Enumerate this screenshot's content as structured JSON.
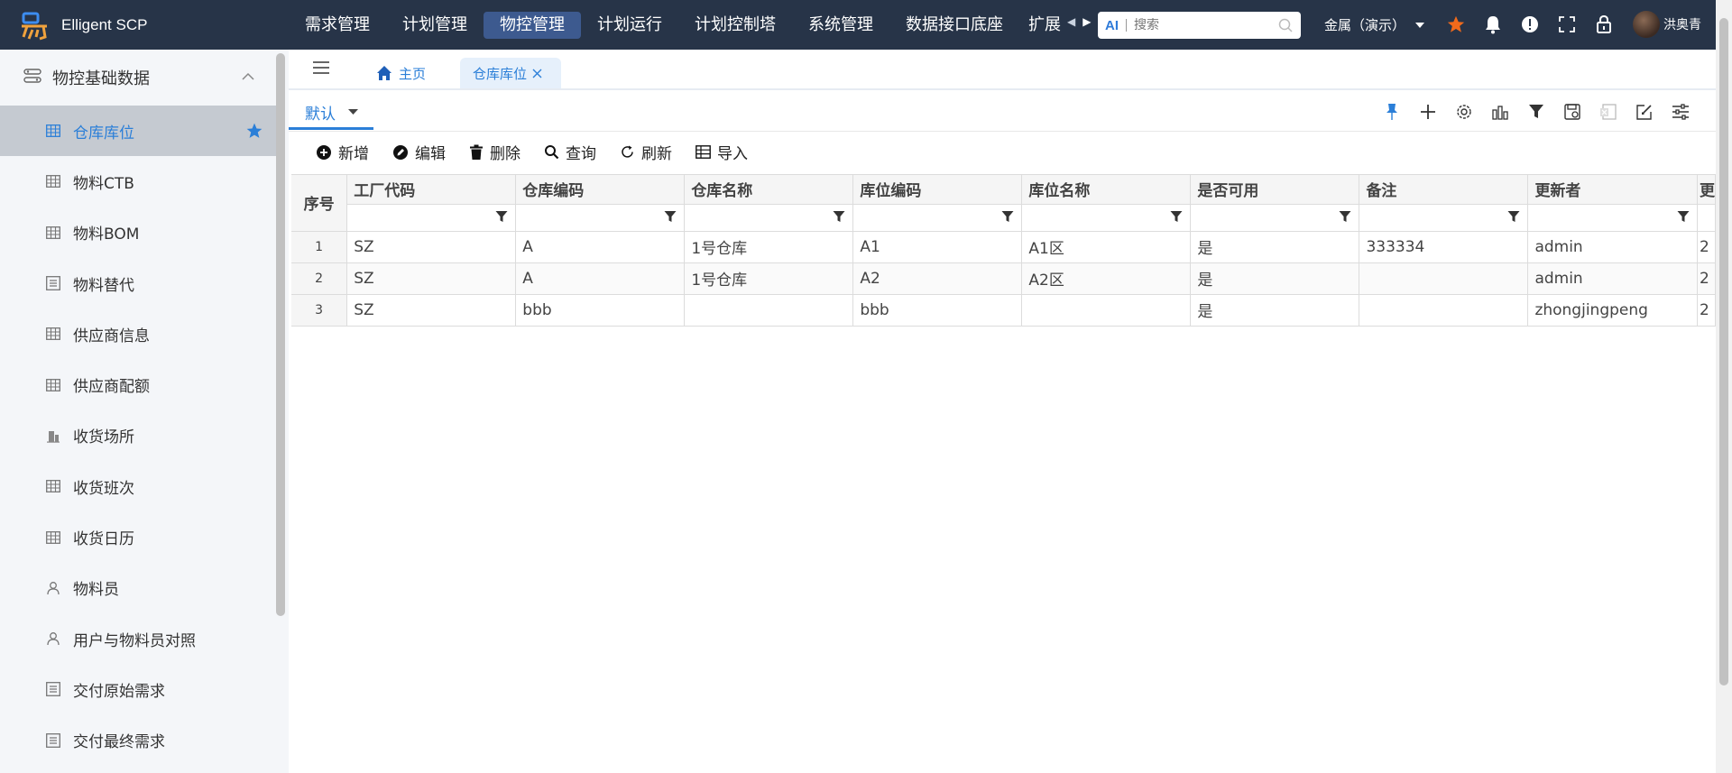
{
  "app": {
    "name": "Elligent SCP"
  },
  "nav": {
    "items": [
      "需求管理",
      "计划管理",
      "物控管理",
      "计划运行",
      "计划控制塔",
      "系统管理",
      "数据接口底座",
      "扩展"
    ],
    "active_index": 2
  },
  "search": {
    "ai_label": "AI",
    "placeholder": "搜索"
  },
  "tenant": {
    "label": "金属（演示）"
  },
  "user": {
    "name": "洪奥青"
  },
  "sidebar": {
    "group_label": "物控基础数据",
    "items": [
      {
        "label": "仓库库位",
        "icon": "table-icon",
        "active": true
      },
      {
        "label": "物料CTB",
        "icon": "table-icon"
      },
      {
        "label": "物料BOM",
        "icon": "table-icon"
      },
      {
        "label": "物料替代",
        "icon": "list-icon"
      },
      {
        "label": "供应商信息",
        "icon": "table-icon"
      },
      {
        "label": "供应商配额",
        "icon": "table-icon"
      },
      {
        "label": "收货场所",
        "icon": "building-icon"
      },
      {
        "label": "收货班次",
        "icon": "table-icon"
      },
      {
        "label": "收货日历",
        "icon": "table-icon"
      },
      {
        "label": "物料员",
        "icon": "user-icon"
      },
      {
        "label": "用户与物料员对照",
        "icon": "user-icon"
      },
      {
        "label": "交付原始需求",
        "icon": "list-icon"
      },
      {
        "label": "交付最终需求",
        "icon": "list-icon"
      }
    ]
  },
  "tabs": {
    "home_label": "主页",
    "active_label": "仓库库位"
  },
  "view": {
    "label": "默认"
  },
  "actions": {
    "add": "新增",
    "edit": "编辑",
    "delete": "删除",
    "query": "查询",
    "refresh": "刷新",
    "import": "导入"
  },
  "grid": {
    "rowno_header": "序号",
    "columns": [
      "工厂代码",
      "仓库编码",
      "仓库名称",
      "库位编码",
      "库位名称",
      "是否可用",
      "备注",
      "更新者",
      "更"
    ],
    "rows": [
      {
        "no": "1",
        "cells": [
          "SZ",
          "A",
          "1号仓库",
          "A1",
          "A1区",
          "是",
          "333334",
          "admin",
          "2"
        ]
      },
      {
        "no": "2",
        "cells": [
          "SZ",
          "A",
          "1号仓库",
          "A2",
          "A2区",
          "是",
          "",
          "admin",
          "2"
        ]
      },
      {
        "no": "3",
        "cells": [
          "SZ",
          "bbb",
          "",
          "bbb",
          "",
          "是",
          "",
          "zhongjingpeng",
          "2"
        ]
      }
    ]
  },
  "colors": {
    "topbar": "#273448",
    "accent": "#2b7fd8",
    "nav_active": "#3d5a8f",
    "star_orange": "#f26a1b"
  }
}
